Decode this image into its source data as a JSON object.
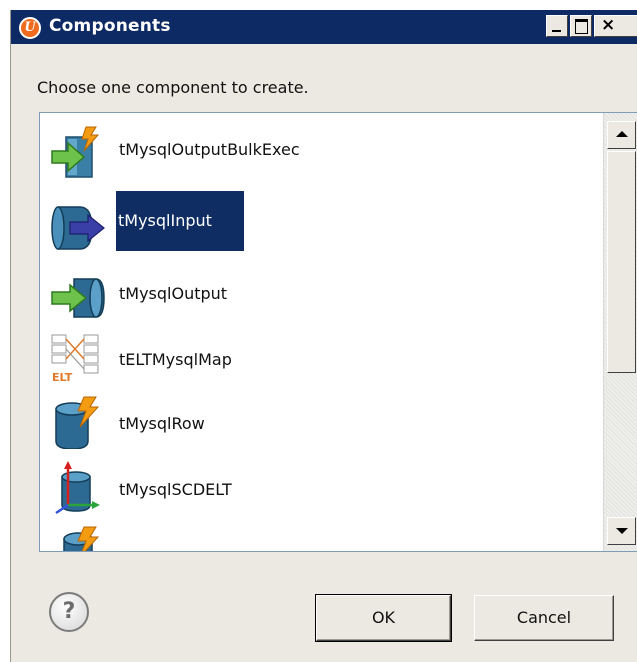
{
  "window": {
    "title": "Components",
    "app_icon_letter": "U",
    "minimize_icon": "minimize-icon",
    "maximize_icon": "maximize-icon",
    "close_glyph": "×"
  },
  "prompt": "Choose one component to create.",
  "components": [
    {
      "label": "tMysqlOutputBulkExec",
      "icon": "bulk-exec-icon",
      "selected": false
    },
    {
      "label": "tMysqlInput",
      "icon": "db-input-icon",
      "selected": true
    },
    {
      "label": "tMysqlOutput",
      "icon": "db-output-icon",
      "selected": false
    },
    {
      "label": "tELTMysqlMap",
      "icon": "elt-map-icon",
      "selected": false
    },
    {
      "label": "tMysqlRow",
      "icon": "db-row-icon",
      "selected": false
    },
    {
      "label": "tMysqlSCDELT",
      "icon": "scd-icon",
      "selected": false
    },
    {
      "label": "",
      "icon": "db-row-icon",
      "selected": false
    }
  ],
  "buttons": {
    "help": "?",
    "ok": "OK",
    "cancel": "Cancel"
  },
  "colors": {
    "titlebar": "#0e2a64",
    "selection": "#0f2c63",
    "dialog_bg": "#ece9e2"
  }
}
